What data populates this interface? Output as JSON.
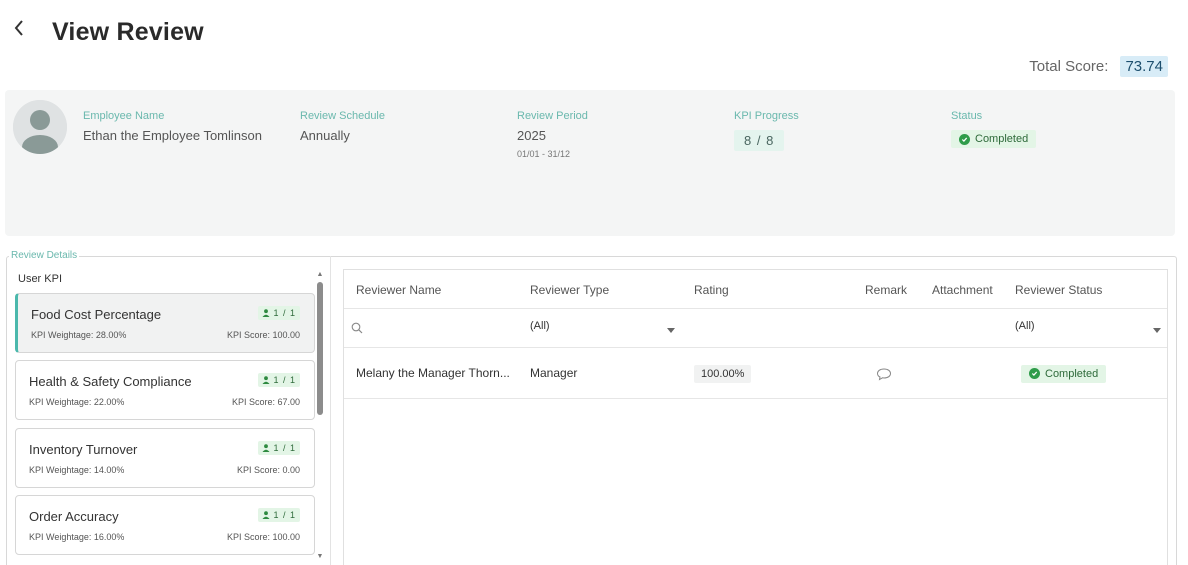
{
  "page": {
    "title": "View Review",
    "back_icon": "chevron-left-icon"
  },
  "total_score": {
    "label": "Total Score:",
    "value": "73.74"
  },
  "employee": {
    "avatar_icon": "user-avatar-icon",
    "name_label": "Employee Name",
    "name": "Ethan the Employee Tomlinson",
    "schedule_label": "Review Schedule",
    "schedule": "Annually",
    "period_label": "Review Period",
    "period_year": "2025",
    "period_range": "01/01 - 31/12",
    "kpi_progress_label": "KPI Progress",
    "kpi_progress": "8 / 8",
    "status_label": "Status",
    "status": "Completed"
  },
  "review_details": {
    "legend": "Review Details",
    "kpi_list_title": "User KPI",
    "kpis": [
      {
        "name": "Food Cost Percentage",
        "count": "1 / 1",
        "weightage": "KPI Weightage: 28.00%",
        "score": "KPI Score: 100.00"
      },
      {
        "name": "Health & Safety Compliance",
        "count": "1 / 1",
        "weightage": "KPI Weightage: 22.00%",
        "score": "KPI Score: 67.00"
      },
      {
        "name": "Inventory Turnover",
        "count": "1 / 1",
        "weightage": "KPI Weightage: 14.00%",
        "score": "KPI Score: 0.00"
      },
      {
        "name": "Order Accuracy",
        "count": "1 / 1",
        "weightage": "KPI Weightage: 16.00%",
        "score": "KPI Score: 100.00"
      }
    ]
  },
  "reviewers_table": {
    "columns": [
      "Reviewer Name",
      "Reviewer Type",
      "Rating",
      "Remark",
      "Attachment",
      "Reviewer Status"
    ],
    "filters": {
      "type_value": "(All)",
      "status_value": "(All)"
    },
    "rows": [
      {
        "name": "Melany the Manager Thorn...",
        "type": "Manager",
        "rating": "100.00%",
        "status": "Completed"
      }
    ]
  },
  "colors": {
    "accent": "#4bb8ac",
    "success": "#2f9c4a",
    "score_bg": "#d8ecf7"
  }
}
